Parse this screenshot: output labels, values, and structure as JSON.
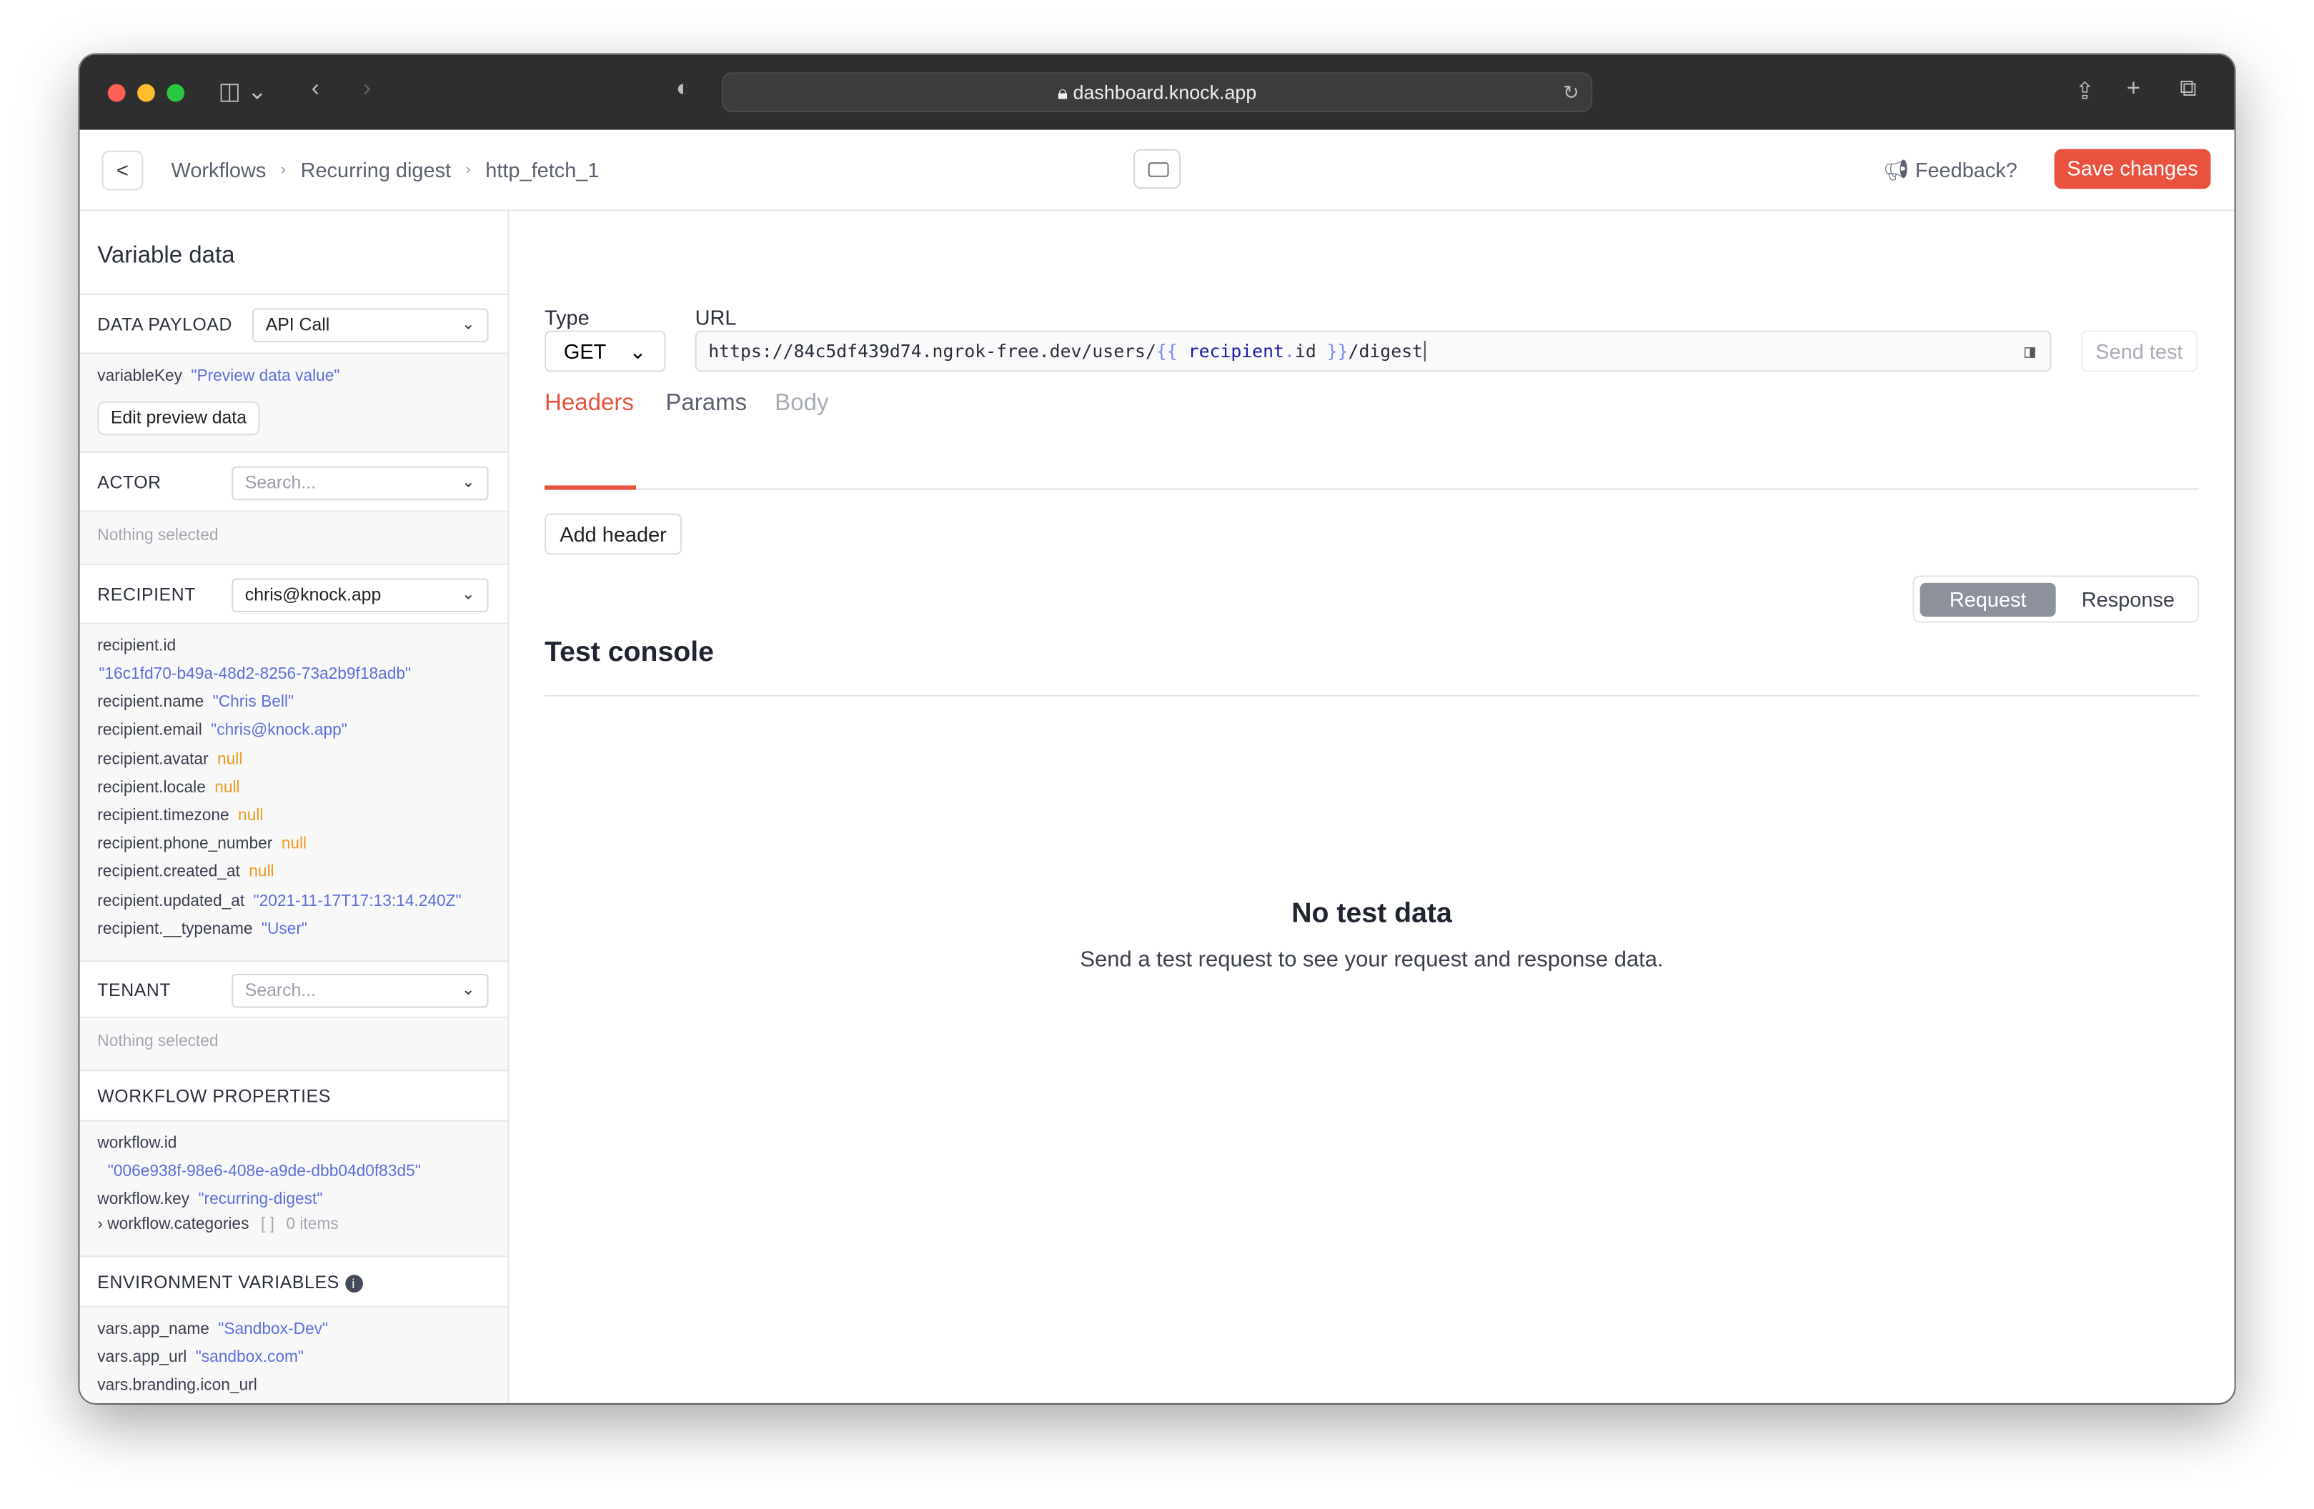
{
  "browser": {
    "address": "dashboard.knock.app"
  },
  "header": {
    "breadcrumbs": [
      "Workflows",
      "Recurring digest",
      "http_fetch_1"
    ],
    "feedback": "Feedback?",
    "save": "Save changes"
  },
  "sidebar": {
    "title": "Variable data",
    "data_payload": {
      "label": "DATA PAYLOAD",
      "value": "API Call"
    },
    "payload_vars": [
      {
        "key": "variableKey",
        "value": "\"Preview data value\""
      }
    ],
    "edit_preview": "Edit preview data",
    "actor": {
      "label": "ACTOR",
      "placeholder": "Search...",
      "empty": "Nothing selected"
    },
    "recipient": {
      "label": "RECIPIENT",
      "value": "chris@knock.app",
      "fields": [
        {
          "key": "recipient.id",
          "value": "\"16c1fd70-b49a-48d2-8256-73a2b9f18adb\""
        },
        {
          "key": "recipient.name",
          "value": "\"Chris Bell\""
        },
        {
          "key": "recipient.email",
          "value": "\"chris@knock.app\""
        },
        {
          "key": "recipient.avatar",
          "value": "null"
        },
        {
          "key": "recipient.locale",
          "value": "null"
        },
        {
          "key": "recipient.timezone",
          "value": "null"
        },
        {
          "key": "recipient.phone_number",
          "value": "null"
        },
        {
          "key": "recipient.created_at",
          "value": "null"
        },
        {
          "key": "recipient.updated_at",
          "value": "\"2021-11-17T17:13:14.240Z\""
        },
        {
          "key": "recipient.__typename",
          "value": "\"User\""
        }
      ]
    },
    "tenant": {
      "label": "TENANT",
      "placeholder": "Search...",
      "empty": "Nothing selected"
    },
    "workflow": {
      "label": "WORKFLOW PROPERTIES",
      "fields": [
        {
          "key": "workflow.id",
          "value": "\"006e938f-98e6-408e-a9de-dbb04d0f83d5\""
        },
        {
          "key": "workflow.key",
          "value": "\"recurring-digest\""
        },
        {
          "key": "workflow.categories",
          "value": "[ ]",
          "count": "0 items"
        }
      ]
    },
    "env": {
      "label": "ENVIRONMENT VARIABLES",
      "fields": [
        {
          "key": "vars.app_name",
          "value": "\"Sandbox-Dev\""
        },
        {
          "key": "vars.app_url",
          "value": "\"sandbox.com\""
        },
        {
          "key": "vars.branding.icon_url",
          "value": ""
        }
      ]
    }
  },
  "main": {
    "type_label": "Type",
    "type_value": "GET",
    "url_label": "URL",
    "url": {
      "prefix": "https://84c5df439d74.ngrok-free.dev/users/",
      "open": "{{",
      "var": "recipient",
      "dot": ".",
      "prop": "id",
      "close": "}}",
      "suffix": "/digest"
    },
    "send_test": "Send test",
    "tabs": [
      {
        "label": "Headers",
        "active": true
      },
      {
        "label": "Params"
      },
      {
        "label": "Body"
      }
    ],
    "add_header": "Add header",
    "console_title": "Test console",
    "console_tabs": [
      "Request",
      "Response"
    ],
    "empty_title": "No test data",
    "empty_text": "Send a test request to see your request and response data."
  },
  "colors": {
    "accent": "#e9523f",
    "string": "#5f6fdc",
    "null": "#f29a1f"
  }
}
